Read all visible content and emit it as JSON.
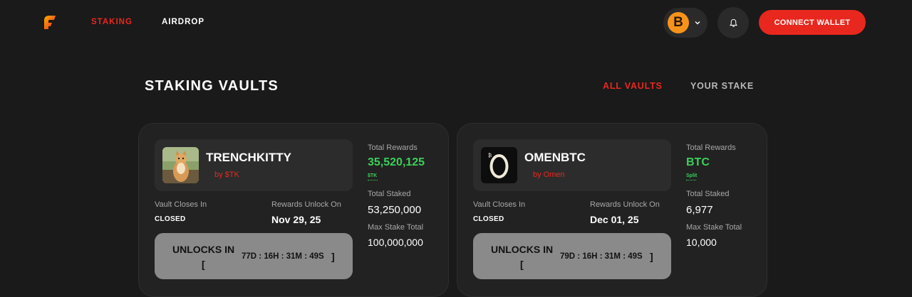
{
  "header": {
    "nav": {
      "staking": "STAKING",
      "airdrop": "AIRDROP"
    },
    "token_selector": {
      "icon": "bitcoin-icon",
      "symbol": "B"
    },
    "connect_label": "CONNECT WALLET"
  },
  "colors": {
    "accent": "#e8281e",
    "reward_green": "#3ccf5a",
    "background": "#1a1a1a",
    "card": "#222222"
  },
  "section": {
    "title": "STAKING VAULTS",
    "tabs": {
      "all": "ALL VAULTS",
      "yours": "YOUR STAKE"
    }
  },
  "vaults": [
    {
      "name": "TRENCHKITTY",
      "by": "by $TK",
      "closes_label": "Vault Closes In",
      "closes_value": "CLOSED",
      "unlock_label": "Rewards Unlock On",
      "unlock_value": "Nov 29, 25",
      "countdown_label": "UNLOCKS IN",
      "countdown_open": "[",
      "countdown_time": "77D : 16H : 31M : 49S",
      "countdown_close": "]",
      "total_rewards_label": "Total Rewards",
      "total_rewards_value": "35,520,125",
      "total_rewards_unit": "$TK",
      "total_staked_label": "Total Staked",
      "total_staked_value": "53,250,000",
      "max_stake_label": "Max Stake Total",
      "max_stake_value": "100,000,000"
    },
    {
      "name": "OMENBTC",
      "by": "by Omen",
      "logo_text": "0",
      "closes_label": "Vault Closes In",
      "closes_value": "CLOSED",
      "unlock_label": "Rewards Unlock On",
      "unlock_value": "Dec 01, 25",
      "countdown_label": "UNLOCKS IN",
      "countdown_open": "[",
      "countdown_time": "79D : 16H : 31M : 49S",
      "countdown_close": "]",
      "total_rewards_label": "Total Rewards",
      "total_rewards_value": "BTC",
      "total_rewards_unit": "Split",
      "total_staked_label": "Total Staked",
      "total_staked_value": "6,977",
      "max_stake_label": "Max Stake Total",
      "max_stake_value": "10,000"
    }
  ]
}
